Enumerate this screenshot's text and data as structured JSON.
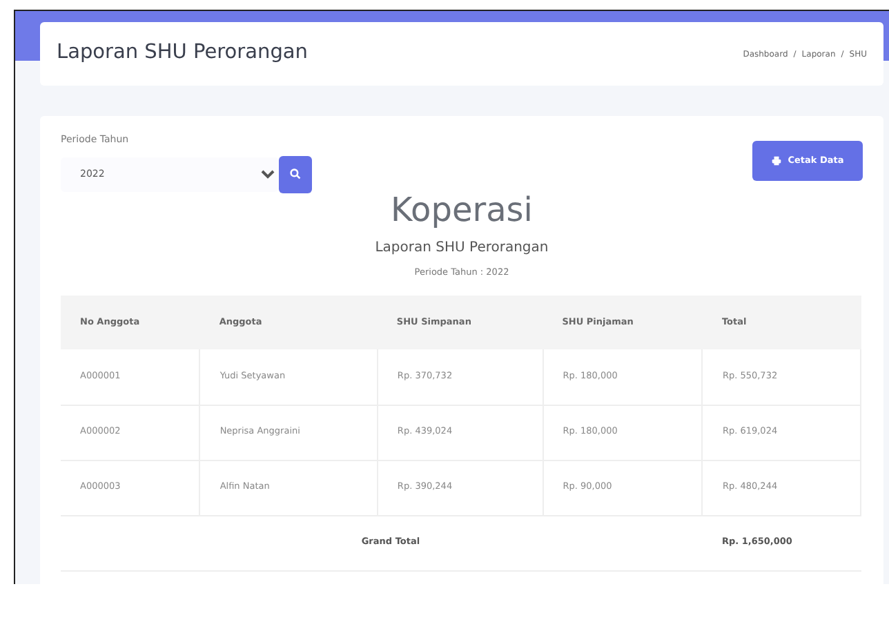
{
  "page_title": "Laporan SHU Perorangan",
  "breadcrumb": [
    {
      "label": "Dashboard",
      "kind": "link"
    },
    {
      "label": "/",
      "kind": "separator"
    },
    {
      "label": "Laporan",
      "kind": "text"
    },
    {
      "label": "/",
      "kind": "separator"
    },
    {
      "label": "SHU",
      "kind": "text"
    }
  ],
  "filter": {
    "label": "Periode Tahun",
    "value": "2022"
  },
  "print_button": {
    "label": "Cetak Data"
  },
  "report": {
    "heading": "Koperasi",
    "subtitle": "Laporan SHU Perorangan",
    "period": "Periode Tahun : 2022"
  },
  "table": {
    "columns": [
      "No Anggota",
      "Anggota",
      "SHU Simpanan",
      "SHU Pinjaman",
      "Total"
    ],
    "rows": [
      [
        "A000001",
        "Yudi Setyawan",
        "Rp. 370,732",
        "Rp. 180,000",
        "Rp. 550,732"
      ],
      [
        "A000002",
        "Neprisa Anggraini",
        "Rp. 439,024",
        "Rp. 180,000",
        "Rp. 619,024"
      ],
      [
        "A000003",
        "Alfin Natan",
        "Rp. 390,244",
        "Rp. 90,000",
        "Rp. 480,244"
      ]
    ],
    "footer": {
      "label": "Grand Total",
      "value": "Rp. 1,650,000"
    }
  }
}
